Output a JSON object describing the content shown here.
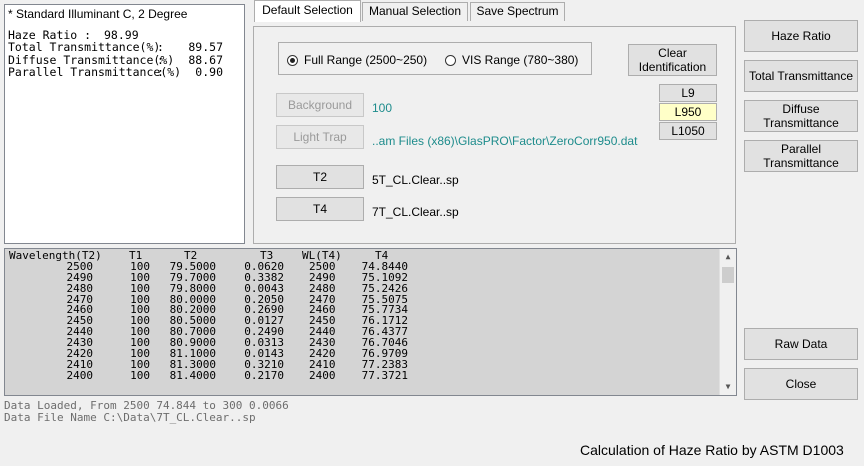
{
  "results": {
    "header": "* Standard Illuminant C, 2 Degree",
    "haze_label": "Haze Ratio :",
    "haze_value": "98.99",
    "rows": [
      {
        "label": "Total Transmittance(%)",
        "colon": ":",
        "value": "89.57"
      },
      {
        "label": "Diffuse Transmittance(%)",
        "colon": ":",
        "value": "88.67"
      },
      {
        "label": "Parallel Transmittance(%)",
        "colon": ":",
        "value": "0.90"
      }
    ]
  },
  "tabs": [
    "Default Selection",
    "Manual Selection",
    "Save Spectrum"
  ],
  "range": {
    "full": "Full Range (2500~250)",
    "vis": "VIS Range (780~380)",
    "selected": "full"
  },
  "buttons": {
    "clear": "Clear Identification",
    "background": "Background",
    "light_trap": "Light Trap",
    "t2": "T2",
    "t4": "T4",
    "l9": "L9",
    "l950": "L950",
    "l1050": "L1050",
    "haze_ratio": "Haze Ratio",
    "total_transmittance": "Total Transmittance",
    "diffuse_transmittance": "Diffuse Transmittance",
    "parallel_transmittance": "Parallel Transmittance",
    "raw_data": "Raw Data",
    "close": "Close"
  },
  "values": {
    "background": "100",
    "light_trap": "..am Files (x86)\\GlasPRO\\Factor\\ZeroCorr950.dat",
    "t2_file": "5T_CL.Clear..sp",
    "t4_file": "7T_CL.Clear..sp"
  },
  "table": {
    "columns": [
      "Wavelength(T2)",
      "T1",
      "T2",
      "T3",
      "WL(T4)",
      "T4"
    ],
    "rows": [
      [
        "2500",
        "100",
        "79.5000",
        "0.0620",
        "2500",
        "74.8440"
      ],
      [
        "2490",
        "100",
        "79.7000",
        "0.3382",
        "2490",
        "75.1092"
      ],
      [
        "2480",
        "100",
        "79.8000",
        "0.0043",
        "2480",
        "75.2426"
      ],
      [
        "2470",
        "100",
        "80.0000",
        "0.2050",
        "2470",
        "75.5075"
      ],
      [
        "2460",
        "100",
        "80.2000",
        "0.2690",
        "2460",
        "75.7734"
      ],
      [
        "2450",
        "100",
        "80.5000",
        "0.0127",
        "2450",
        "76.1712"
      ],
      [
        "2440",
        "100",
        "80.7000",
        "0.2490",
        "2440",
        "76.4377"
      ],
      [
        "2430",
        "100",
        "80.9000",
        "0.0313",
        "2430",
        "76.7046"
      ],
      [
        "2420",
        "100",
        "81.1000",
        "0.0143",
        "2420",
        "76.9709"
      ],
      [
        "2410",
        "100",
        "81.3000",
        "0.3210",
        "2410",
        "77.2383"
      ],
      [
        "2400",
        "100",
        "81.4000",
        "0.2170",
        "2400",
        "77.3721"
      ]
    ]
  },
  "status": {
    "line1": "Data Loaded, From 2500  74.844 to 300  0.0066",
    "line2": "Data File Name C:\\Data\\7T_CL.Clear..sp"
  },
  "footer": "Calculation of Haze Ratio by ASTM D1003"
}
